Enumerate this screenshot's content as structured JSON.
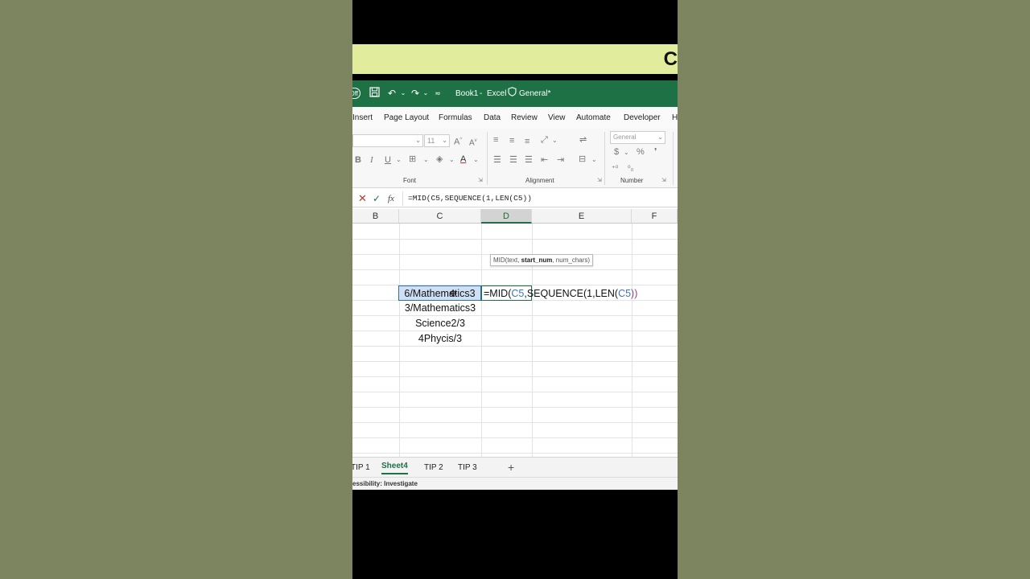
{
  "banner": {
    "text": "C"
  },
  "titlebar": {
    "autosave": "Off",
    "doc_name": "Book1",
    "separator": "-",
    "app_name": "Excel",
    "sensitivity": "General*"
  },
  "menu": [
    "Insert",
    "Page Layout",
    "Formulas",
    "Data",
    "Review",
    "View",
    "Automate",
    "Developer",
    "H"
  ],
  "ribbon": {
    "font_size": "11",
    "number_format": "General",
    "groups": {
      "font": "Font",
      "alignment": "Alignment",
      "number": "Number"
    }
  },
  "formula_bar": {
    "value": "=MID(C5,SEQUENCE(1,LEN(C5))"
  },
  "columns": [
    "B",
    "C",
    "D",
    "E",
    "F"
  ],
  "selected_column": "D",
  "cells": {
    "c5": "6/Mathematics3",
    "c6": "3/Mathematics3",
    "c7": "Science2/3",
    "c8": "4Phycis/3",
    "d5_prefix": "=MID(",
    "d5_ref1": "C5",
    "d5_mid": ",SEQUENCE(1,LEN(",
    "d5_ref2": "C5",
    "d5_suffix": "))"
  },
  "tooltip": {
    "fn": "MID(",
    "arg1": "text, ",
    "arg2": "start_num",
    "arg3": ", num_chars)"
  },
  "sheets": [
    "TIP 1",
    "Sheet4",
    "TIP 2",
    "TIP 3"
  ],
  "active_sheet": "Sheet4",
  "add_sheet": "+",
  "status": "essibility: Investigate",
  "colors": {
    "excel_green": "#1e7145",
    "banner": "#e1ec9c",
    "selection": "#cfe0f5",
    "reference": "#3d73b9"
  }
}
